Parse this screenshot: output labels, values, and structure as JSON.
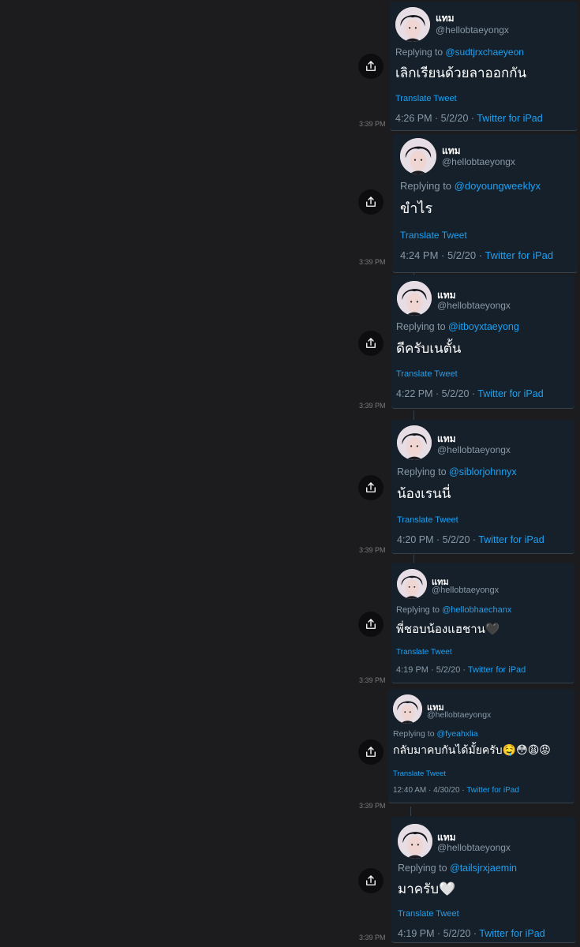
{
  "timestamp": "3:39 PM",
  "tweets": [
    {
      "name": "แทม",
      "handle": "@hellobtaeyongx",
      "replying_prefix": "Replying to ",
      "replying_to": "@sudtjrxchaeyeon",
      "text": "เลิกเรียนด้วยลาออกกัน",
      "translate": "Translate Tweet",
      "time_date": "4:26 PM · 5/2/20 · ",
      "source": "Twitter for iPad"
    },
    {
      "name": "แทม",
      "handle": "@hellobtaeyongx",
      "replying_prefix": "Replying to ",
      "replying_to": "@doyoungweeklyx",
      "text": "ขำไร",
      "translate": "Translate Tweet",
      "time_date": "4:24 PM · 5/2/20 · ",
      "source": "Twitter for iPad"
    },
    {
      "name": "แทม",
      "handle": "@hellobtaeyongx",
      "replying_prefix": "Replying to ",
      "replying_to": "@itboyxtaeyong",
      "text": "ดีครับเนตั้น",
      "translate": "Translate Tweet",
      "time_date": "4:22 PM · 5/2/20 · ",
      "source": "Twitter for iPad"
    },
    {
      "name": "แทม",
      "handle": "@hellobtaeyongx",
      "replying_prefix": "Replying to ",
      "replying_to": "@siblorjohnnyx",
      "text": "น้องเรนนี่",
      "translate": "Translate Tweet",
      "time_date": "4:20 PM · 5/2/20 · ",
      "source": "Twitter for iPad"
    },
    {
      "name": "แทม",
      "handle": "@hellobtaeyongx",
      "replying_prefix": "Replying to ",
      "replying_to": "@hellobhaechanx",
      "text": "พี่ชอบน้องแฮชาน🖤",
      "translate": "Translate Tweet",
      "time_date": "4:19 PM · 5/2/20 · ",
      "source": "Twitter for iPad"
    },
    {
      "name": "แทม",
      "handle": "@hellobtaeyongx",
      "replying_prefix": "Replying to ",
      "replying_to": "@fyeahxlia",
      "text": "กลับมาคบกันได้มั้ยครับ🤤😳😩😡",
      "translate": "Translate Tweet",
      "time_date": "12:40 AM · 4/30/20 · ",
      "source": "Twitter for iPad"
    },
    {
      "name": "แทม",
      "handle": "@hellobtaeyongx",
      "replying_prefix": "Replying to ",
      "replying_to": "@tailsjrxjaemin",
      "text": "มาครับ🤍",
      "translate": "Translate Tweet",
      "time_date": "4:19 PM · 5/2/20 · ",
      "source": "Twitter for iPad"
    }
  ],
  "icons": {
    "share": "share-icon",
    "avatar": "avatar"
  },
  "colors": {
    "background": "#1c1c1e",
    "card": "#15202b",
    "link": "#1da1f2",
    "muted": "#8899a6",
    "text": "#ffffff"
  }
}
